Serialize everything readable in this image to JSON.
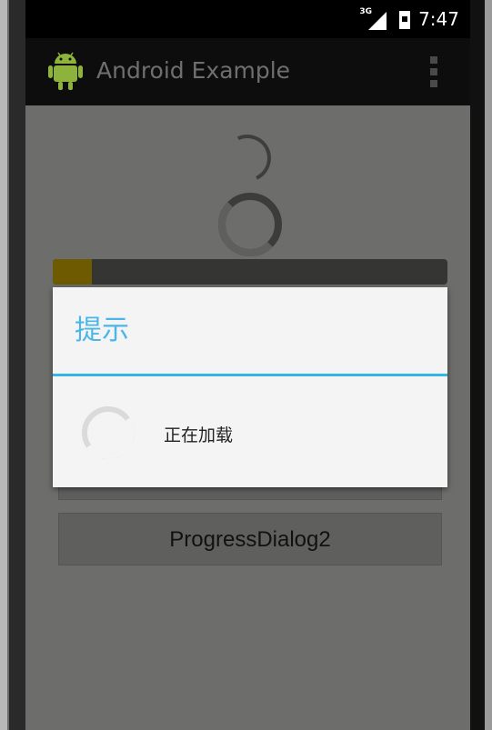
{
  "statusbar": {
    "network": "3G",
    "time": "7:47"
  },
  "actionbar": {
    "title": "Android Example",
    "app_icon": "android-robot-icon",
    "overflow_icon": "overflow-menu-icon"
  },
  "progress": {
    "horizontal_fraction": 0.1
  },
  "buttons": {
    "first_label": "",
    "second_label": "ProgressDialog2"
  },
  "dialog": {
    "title": "提示",
    "message": "正在加载",
    "accent": "#33b5e5"
  },
  "colors": {
    "background": "#6d6e6b",
    "progress_fill": "#6e5a00",
    "dialog_bg": "#f4f4f4"
  }
}
